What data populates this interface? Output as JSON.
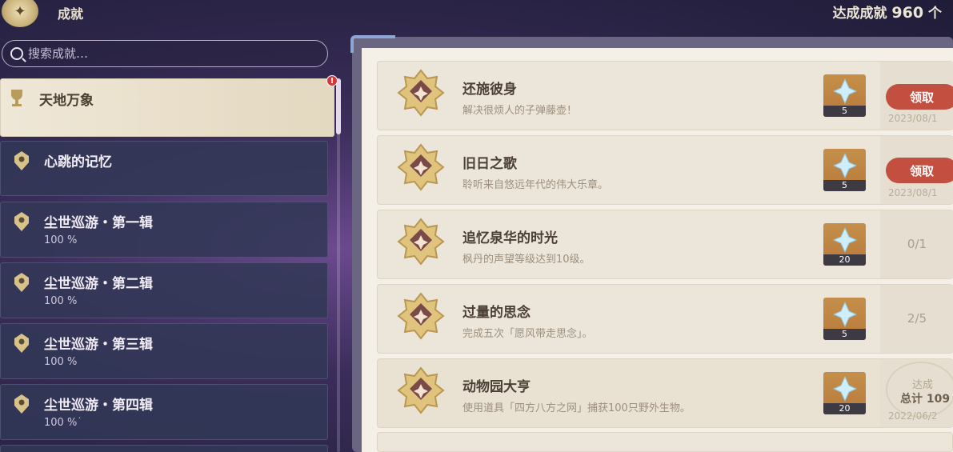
{
  "header": {
    "title": "成就",
    "total_label": "达成成就",
    "total_count": "960",
    "total_unit": "个"
  },
  "search": {
    "placeholder": "搜索成就…"
  },
  "sidebar": {
    "badge": "!",
    "items": [
      {
        "label": "天地万象",
        "percent": ""
      },
      {
        "label": "心跳的记忆",
        "percent": ""
      },
      {
        "label": "尘世巡游・第一辑",
        "percent": "100 %"
      },
      {
        "label": "尘世巡游・第二辑",
        "percent": "100 %"
      },
      {
        "label": "尘世巡游・第三辑",
        "percent": "100 %"
      },
      {
        "label": "尘世巡游・第四辑",
        "percent": "100 %˙"
      }
    ]
  },
  "achievements": [
    {
      "name": "还施彼身",
      "desc": "解决很烦人的子弹藤壶！",
      "reward": "5",
      "status": "claim",
      "button": "领取",
      "date": "2023/08/1"
    },
    {
      "name": "旧日之歌",
      "desc": "聆听来自悠远年代的伟大乐章。",
      "reward": "5",
      "status": "claim",
      "button": "领取",
      "date": "2023/08/1"
    },
    {
      "name": "追忆泉华的时光",
      "desc": "枫丹的声望等级达到10级。",
      "reward": "20",
      "status": "progress",
      "progress": "0/1"
    },
    {
      "name": "过量的思念",
      "desc": "完成五次「愿风带走思念」。",
      "reward": "5",
      "status": "progress",
      "progress": "2/5"
    },
    {
      "name": "动物园大亨",
      "desc": "使用道具「四方八方之网」捕获100只野外生物。",
      "reward": "20",
      "status": "done",
      "stamp_top": "达成",
      "stamp_bottom": "总计 109",
      "date": "2022/06/2"
    }
  ],
  "colors": {
    "claim_button": "#c24f3f",
    "reward_bg": "#c58f4b",
    "panel_bg": "#f4f0e7",
    "active_category_bg": "#efe7d7"
  }
}
